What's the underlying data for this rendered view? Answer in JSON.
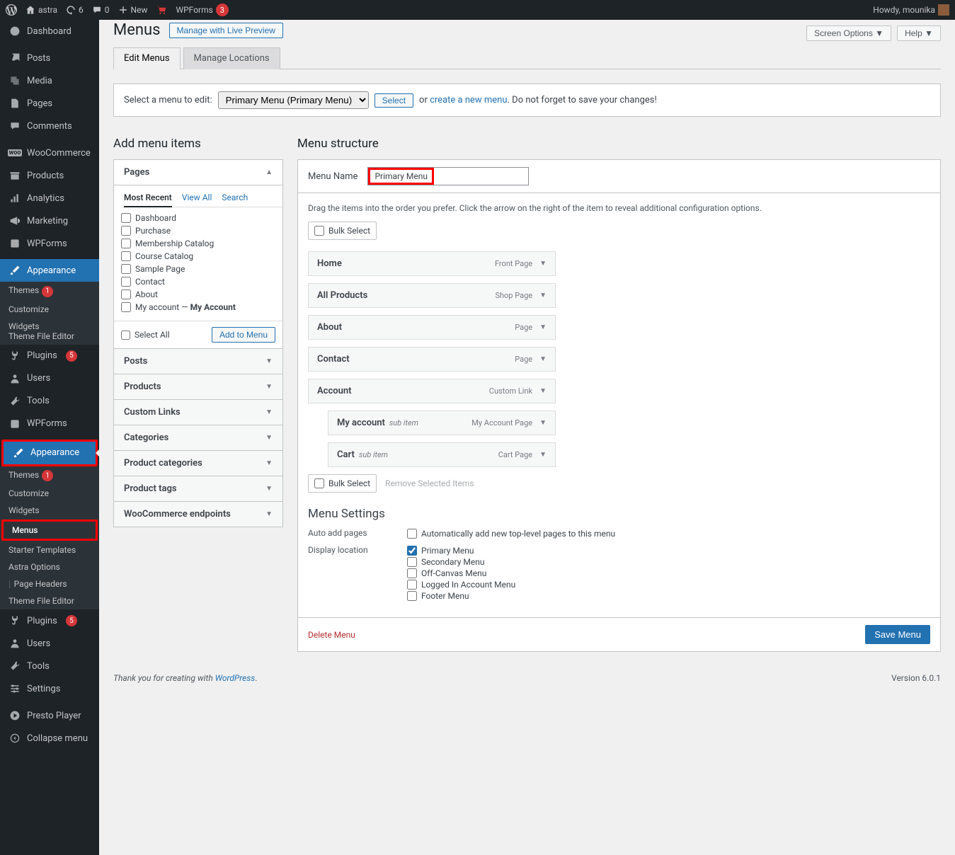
{
  "adminbar": {
    "site_name": "astra",
    "updates": "6",
    "comments": "0",
    "new_label": "New",
    "wpforms": "WPForms",
    "wpforms_badge": "3",
    "howdy": "Howdy, mounika"
  },
  "sidebar": {
    "dashboard": "Dashboard",
    "posts": "Posts",
    "media": "Media",
    "pages": "Pages",
    "comments": "Comments",
    "woocommerce": "WooCommerce",
    "products": "Products",
    "analytics": "Analytics",
    "marketing": "Marketing",
    "wpforms": "WPForms",
    "appearance": "Appearance",
    "sub1": {
      "themes": "Themes",
      "themes_badge": "1",
      "customize": "Customize",
      "widgets": "Widgets",
      "editor": "Theme File Editor"
    },
    "plugins": "Plugins",
    "plugins_badge": "5",
    "users": "Users",
    "tools": "Tools",
    "wpforms2": "WPForms",
    "appearance2": "Appearance",
    "sub2": {
      "themes": "Themes",
      "themes_badge": "1",
      "customize": "Customize",
      "widgets": "Widgets",
      "menus": "Menus",
      "starter": "Starter Templates",
      "astra": "Astra Options",
      "pageheaders": "Page Headers",
      "editor": "Theme File Editor"
    },
    "plugins2": "Plugins",
    "plugins2_badge": "5",
    "users2": "Users",
    "tools2": "Tools",
    "settings": "Settings",
    "presto": "Presto Player",
    "collapse": "Collapse menu"
  },
  "header": {
    "screen_options": "Screen Options",
    "help": "Help",
    "title": "Menus",
    "live_preview": "Manage with Live Preview"
  },
  "tabs": {
    "edit": "Edit Menus",
    "locations": "Manage Locations"
  },
  "selectbar": {
    "label": "Select a menu to edit:",
    "selected": "Primary Menu (Primary Menu)",
    "select_btn": "Select",
    "or": "or",
    "create": "create a new menu",
    "suffix": ". Do not forget to save your changes!"
  },
  "add_items": {
    "heading": "Add menu items",
    "pages": "Pages",
    "pages_tabs": {
      "recent": "Most Recent",
      "all": "View All",
      "search": "Search"
    },
    "page_items": [
      "Dashboard",
      "Purchase",
      "Membership Catalog",
      "Course Catalog",
      "Sample Page",
      "Contact",
      "About"
    ],
    "my_account_a": "My account",
    "my_account_b": "My Account",
    "select_all": "Select All",
    "add_btn": "Add to Menu",
    "posts": "Posts",
    "products": "Products",
    "custom": "Custom Links",
    "cats": "Categories",
    "prodcats": "Product categories",
    "prodtags": "Product tags",
    "wc_endpoints": "WooCommerce endpoints"
  },
  "structure": {
    "heading": "Menu structure",
    "name_label": "Menu Name",
    "name_value": "Primary Menu",
    "hint": "Drag the items into the order you prefer. Click the arrow on the right of the item to reveal additional configuration options.",
    "bulk_select": "Bulk Select",
    "remove_selected": "Remove Selected Items",
    "items": [
      {
        "label": "Home",
        "type": "Front Page",
        "sub": false,
        "subtext": ""
      },
      {
        "label": "All Products",
        "type": "Shop Page",
        "sub": false,
        "subtext": ""
      },
      {
        "label": "About",
        "type": "Page",
        "sub": false,
        "subtext": ""
      },
      {
        "label": "Contact",
        "type": "Page",
        "sub": false,
        "subtext": ""
      },
      {
        "label": "Account",
        "type": "Custom Link",
        "sub": false,
        "subtext": ""
      },
      {
        "label": "My account",
        "type": "My Account Page",
        "sub": true,
        "subtext": "sub item"
      },
      {
        "label": "Cart",
        "type": "Cart Page",
        "sub": true,
        "subtext": "sub item"
      }
    ],
    "settings_heading": "Menu Settings",
    "auto_add_label": "Auto add pages",
    "auto_add_text": "Automatically add new top-level pages to this menu",
    "display_loc_label": "Display location",
    "locations": [
      {
        "label": "Primary Menu",
        "checked": true
      },
      {
        "label": "Secondary Menu",
        "checked": false
      },
      {
        "label": "Off-Canvas Menu",
        "checked": false
      },
      {
        "label": "Logged In Account Menu",
        "checked": false
      },
      {
        "label": "Footer Menu",
        "checked": false
      }
    ],
    "delete": "Delete Menu",
    "save": "Save Menu"
  },
  "footer": {
    "thanks_a": "Thank you for creating with ",
    "thanks_b": "WordPress",
    "thanks_c": ".",
    "version": "Version 6.0.1"
  }
}
